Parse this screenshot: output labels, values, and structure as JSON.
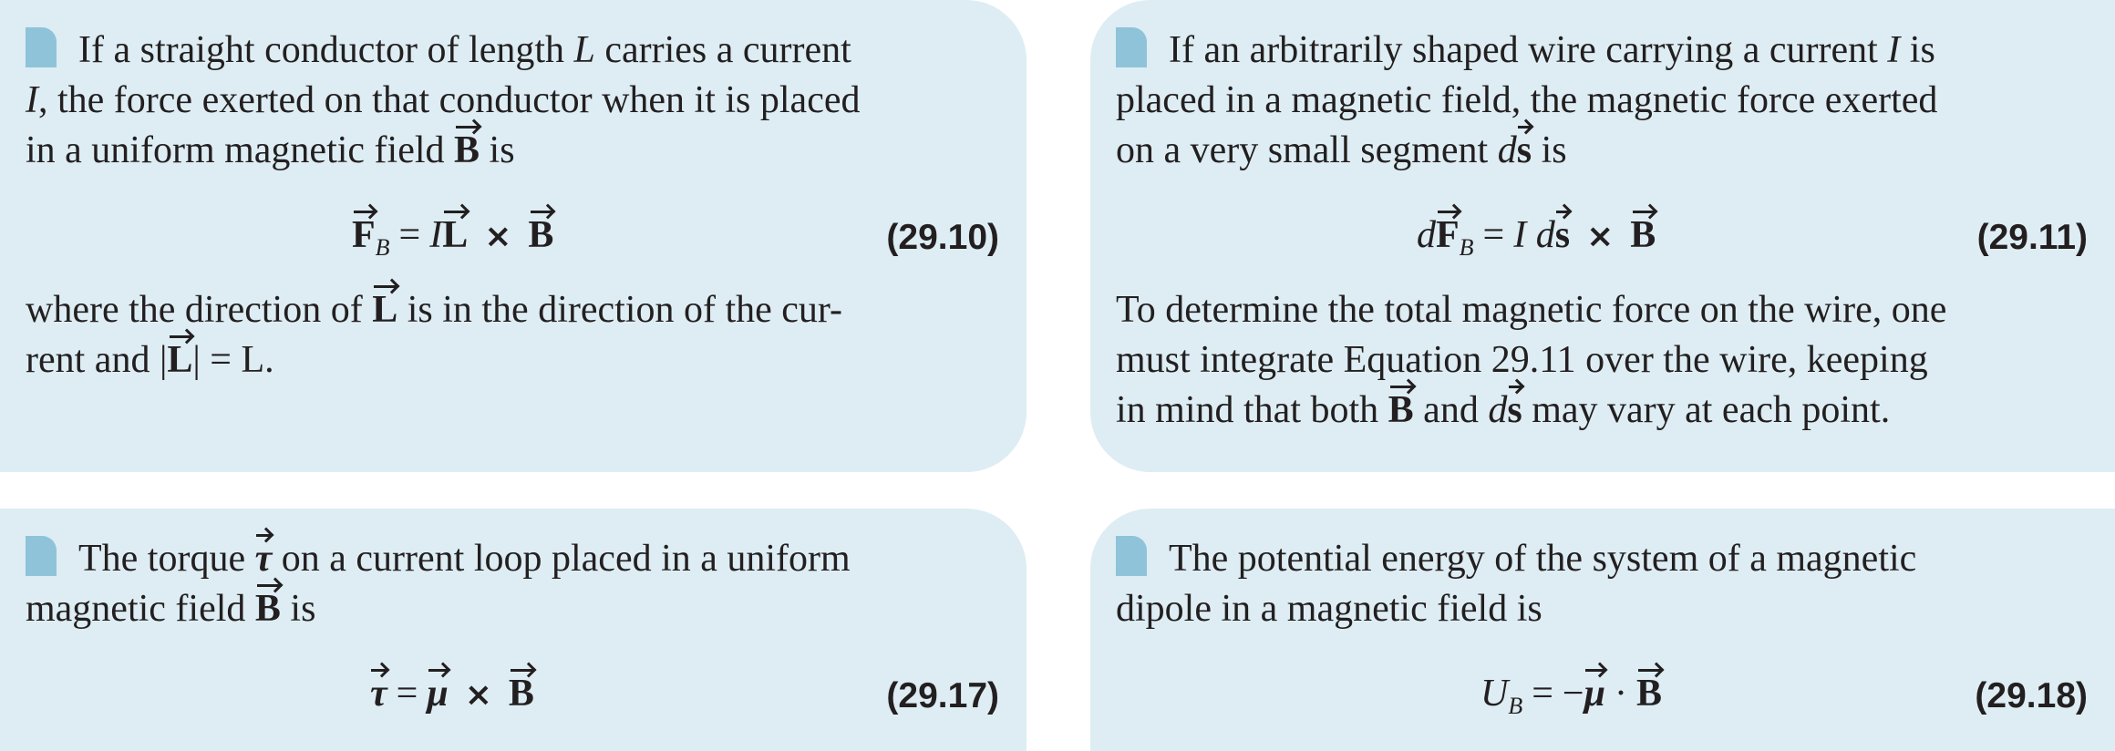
{
  "cards": {
    "force_straight": {
      "intro": "If a straight conductor of length L carries a current I, the force exerted on that conductor when it is placed in a uniform magnetic field B is",
      "equation_number": "(29.10)",
      "after_a": "where the direction of ",
      "after_b": " is in the direction of the cur-",
      "after_c": "rent and |",
      "after_d": "| = L."
    },
    "force_segment": {
      "intro": "If an arbitrarily shaped wire carrying a current I is placed in a magnetic field, the magnetic force exerted on a very small segment ds is",
      "equation_number": "(29.11)",
      "after_line1": "To determine the total magnetic force on the wire, one",
      "after_line2": "must integrate Equation 29.11 over the wire, keeping",
      "after_line3a": "in mind that both ",
      "after_line3b": " and ",
      "after_line3c": " may vary at each point."
    },
    "torque": {
      "intro_a": "The torque ",
      "intro_b": " on a current loop placed in a uniform",
      "intro_c": "magnetic field ",
      "intro_d": " is",
      "equation_number": "(29.17)"
    },
    "potential": {
      "intro_line1": "The potential energy of the system of a magnetic",
      "intro_line2": "dipole in a magnetic field is",
      "equation_number": "(29.18)"
    }
  },
  "symbols": {
    "F": "F",
    "B": "B",
    "L": "L",
    "s": "s",
    "tau": "τ",
    "mu": "μ",
    "I": "I",
    "d": "d",
    "U": "U",
    "sub_B": "B",
    "eq": "=",
    "times": "×",
    "dot": "·",
    "minus": "−"
  }
}
